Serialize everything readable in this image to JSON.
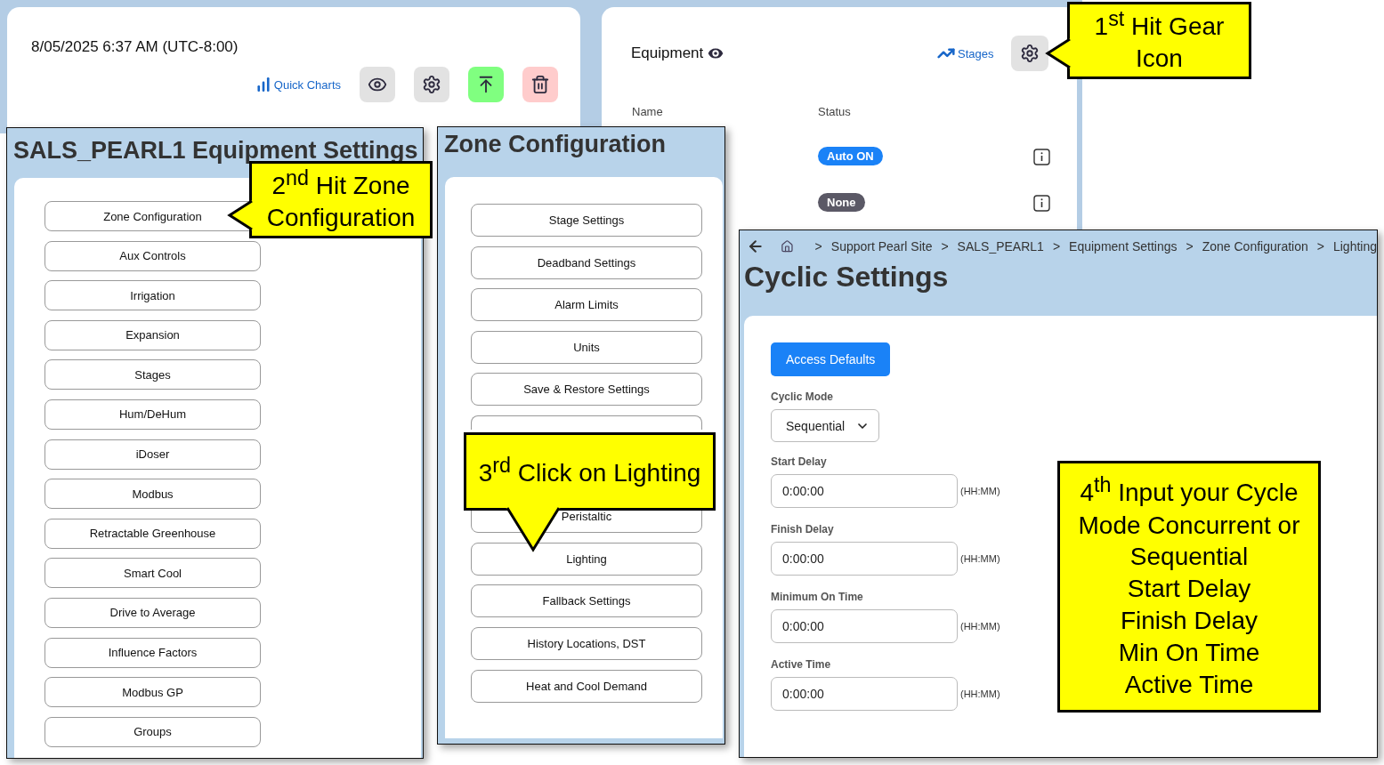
{
  "dashboard": {
    "datetime": "8/05/2025 6:37 AM (UTC-8:00)",
    "quick_charts": "Quick Charts",
    "buttons": [
      {
        "kind": "view"
      },
      {
        "kind": "settings"
      },
      {
        "kind": "upload"
      },
      {
        "kind": "delete"
      }
    ]
  },
  "equipment": {
    "title": "Equipment",
    "stages_link": "Stages",
    "columns": [
      "Name",
      "Status"
    ],
    "rows": [
      {
        "status": "Auto ON",
        "color": "#1a82f7"
      },
      {
        "status": "None",
        "color": "#5b5966"
      }
    ]
  },
  "equipment_settings": {
    "title": "SALS_PEARL1 Equipment Settings",
    "items": [
      "Zone Configuration",
      "Aux Controls",
      "Irrigation",
      "Expansion",
      "Stages",
      "Hum/DeHum",
      "iDoser",
      "Modbus",
      "Retractable Greenhouse",
      "Smart Cool",
      "Drive to Average",
      "Influence Factors",
      "Modbus GP",
      "Groups"
    ]
  },
  "zone_configuration": {
    "title": "Zone Configuration",
    "items": [
      {
        "kind": "button",
        "label": "Stage Settings"
      },
      {
        "kind": "button",
        "label": "Deadband Settings"
      },
      {
        "kind": "button",
        "label": "Alarm Limits"
      },
      {
        "kind": "button",
        "label": "Units"
      },
      {
        "kind": "button",
        "label": "Save & Restore Settings"
      },
      {
        "kind": "covered"
      },
      {
        "kind": "button",
        "label": "Peristaltic"
      },
      {
        "kind": "button",
        "label": "Lighting"
      },
      {
        "kind": "button",
        "label": "Fallback Settings"
      },
      {
        "kind": "button",
        "label": "History Locations, DST"
      },
      {
        "kind": "button",
        "label": "Heat and Cool Demand"
      }
    ]
  },
  "cyclic_settings": {
    "separator": ">",
    "breadcrumb": [
      "Support Pearl Site",
      "SALS_PEARL1",
      "Equipment Settings",
      "Zone Configuration",
      "Lighting"
    ],
    "title": "Cyclic Settings",
    "access_defaults": "Access Defaults",
    "cyclic_mode": {
      "label": "Cyclic Mode",
      "value": "Sequential"
    },
    "time_fields": [
      {
        "label": "Start Delay",
        "value": "0:00:00",
        "unit": "(HH:MM)"
      },
      {
        "label": "Finish Delay",
        "value": "0:00:00",
        "unit": "(HH:MM)"
      },
      {
        "label": "Minimum On Time",
        "value": "0:00:00",
        "unit": "(HH:MM)"
      },
      {
        "label": "Active Time",
        "value": "0:00:00",
        "unit": "(HH:MM)"
      }
    ]
  },
  "callouts": [
    {
      "text": "1$^{st}$ Hit Gear\nIcon",
      "kind": "left"
    },
    {
      "text": "2$^{nd}$ Hit Zone\nConfiguration",
      "kind": "left"
    },
    {
      "text": "3$^{rd}$ Click on Lighting",
      "kind": "down"
    },
    {
      "text": "4$^{th}$ Input your Cycle\nMode Concurrent or\nSequential\nStart Delay\nFinish Delay\nMin On Time\nActive Time",
      "kind": "plain"
    }
  ]
}
